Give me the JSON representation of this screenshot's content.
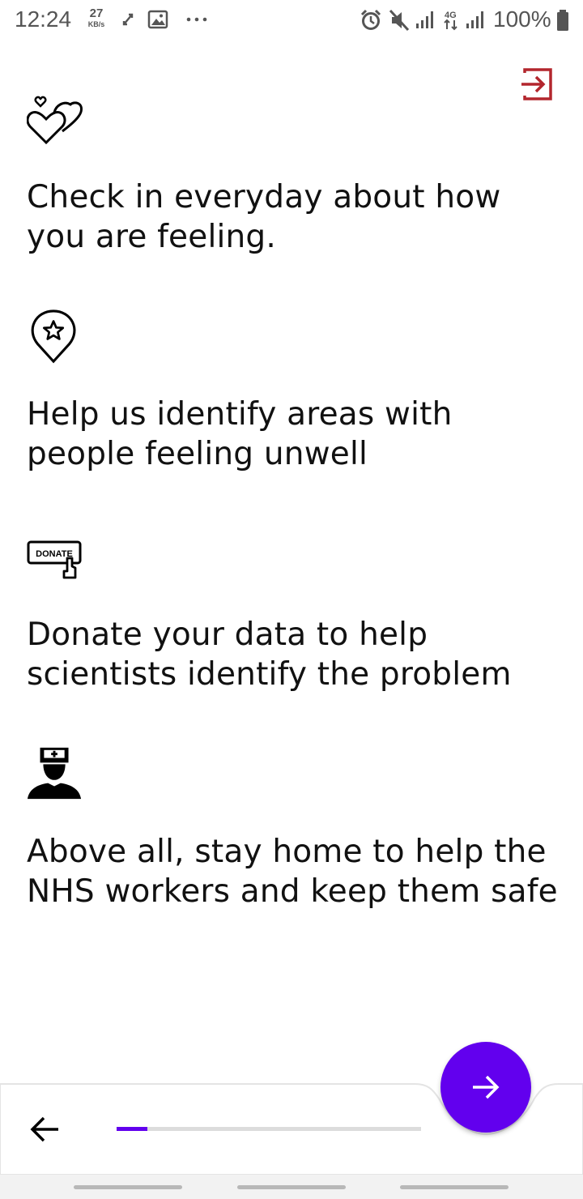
{
  "status_bar": {
    "time": "12:24",
    "net_speed_value": "27",
    "net_speed_unit": "KB/s",
    "network_label": "4G",
    "battery_percent": "100%",
    "icons": [
      "vpn-key-icon",
      "gallery-icon",
      "more-dots-icon",
      "alarm-icon",
      "mute-icon",
      "signal-icon",
      "data-4g-icon",
      "signal-icon",
      "battery-icon"
    ]
  },
  "header": {
    "exit_icon": "exit-icon",
    "accent_color": "#b3262d"
  },
  "features": [
    {
      "icon": "hearts-icon",
      "text": "Check in everyday about how you are feeling."
    },
    {
      "icon": "location-star-icon",
      "text": "Help us identify areas with people feeling unwell"
    },
    {
      "icon": "donate-button-icon",
      "icon_label": "DONATE",
      "text": "Donate your data to help scientists identify the problem"
    },
    {
      "icon": "nurse-icon",
      "text": "Above all, stay home to help the NHS workers and keep them safe"
    }
  ],
  "bottom_bar": {
    "back_icon": "arrow-left-icon",
    "next_icon": "arrow-right-icon",
    "progress_fraction": 0.1,
    "accent_color": "#6200ee"
  }
}
